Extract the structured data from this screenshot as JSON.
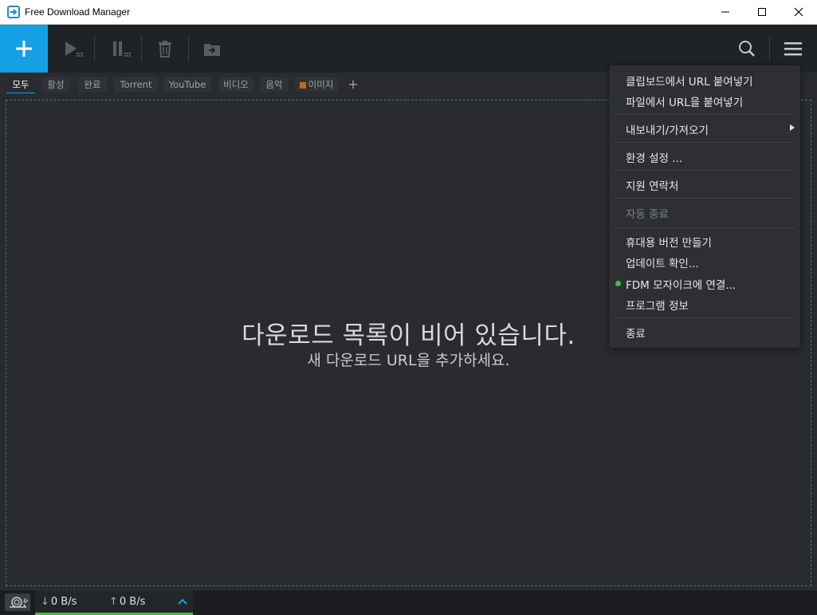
{
  "window": {
    "title": "Free Download Manager"
  },
  "colors": {
    "accent": "#16a0e4",
    "background": "#292b2e",
    "toolbar": "#1f2226",
    "menu": "#2d2f33",
    "status_green": "#3cc43c"
  },
  "toolbar": {
    "icons": [
      "add-icon",
      "play-icon",
      "pause-icon",
      "trash-icon",
      "move-icon",
      "search-icon",
      "hamburger-menu-icon"
    ]
  },
  "tabs": [
    {
      "label": "모두",
      "active": true
    },
    {
      "label": "활성",
      "active": false
    },
    {
      "label": "완료",
      "active": false
    },
    {
      "label": "Torrent",
      "active": false
    },
    {
      "label": "YouTube",
      "active": false
    },
    {
      "label": "비디오",
      "active": false
    },
    {
      "label": "음악",
      "active": false
    },
    {
      "label": "이미지",
      "active": false
    },
    {
      "label": "+",
      "active": false
    }
  ],
  "empty_state": {
    "title": "다운로드 목록이 비어 있습니다.",
    "subtitle": "새 다운로드 URL을 추가하세요."
  },
  "menu": {
    "items": [
      {
        "label": "클립보드에서 URL 붙여넣기",
        "enabled": true
      },
      {
        "label": "파일에서 URL을 붙여넣기",
        "enabled": true
      },
      {
        "label": "내보내기/가져오기",
        "enabled": true,
        "submenu": true
      },
      {
        "label": "환경 설정 ...",
        "enabled": true
      },
      {
        "label": "지원 연락처",
        "enabled": true
      },
      {
        "label": "자동 종료",
        "enabled": false
      },
      {
        "label": "휴대용 버전 만들기",
        "enabled": true
      },
      {
        "label": "업데이트 확인...",
        "enabled": true
      },
      {
        "label": "FDM 모자이크에 연결...",
        "enabled": true,
        "status_dot": "green"
      },
      {
        "label": "프로그램 정보",
        "enabled": true
      },
      {
        "label": "종료",
        "enabled": true
      }
    ]
  },
  "status": {
    "download_arrow": "↓",
    "upload_arrow": "↑",
    "download_speed": "0 B/s",
    "upload_speed": "0 B/s"
  }
}
